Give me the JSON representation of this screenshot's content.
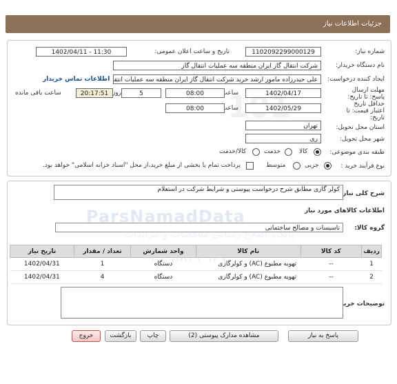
{
  "header": {
    "title": "جزئیات اطلاعات نیاز"
  },
  "info": {
    "need_number_label": "شماره نیاز:",
    "need_number": "1102092299000129",
    "announce_label": "تاریخ و ساعت اعلان عمومی:",
    "announce_value": "1402/04/11 - 11:30",
    "buyer_org_label": "نام دستگاه خریدار:",
    "buyer_org": "شرکت انتقال گاز ایران منطقه سه عملیات انتقال گاز",
    "creator_label": "ایجاد کننده درخواست:",
    "creator": "علی حیدرزاده مامور ارشد خرید شرکت انتقال گاز ایران منطقه سه عملیات انتقال",
    "contact_link": "اطلاعات تماس خریدار",
    "send_deadline_label": "مهلت ارسال پاسخ: تا تاریخ:",
    "send_deadline_date": "1402/04/17",
    "time_label": "ساعت",
    "send_deadline_time": "08:00",
    "days": "5",
    "day_and_label": "روز و",
    "remaining_time": "20:17:51",
    "remaining_label": "ساعت باقی مانده",
    "validity_label": "حداقل تاریخ اعتبار قیمت: تا تاریخ:",
    "validity_date": "1402/05/29",
    "validity_time_label": "ساعت",
    "validity_time": "08:00",
    "province_label": "استان محل تحویل:",
    "province": "تهران",
    "city_label": "شهر محل تحویل:",
    "city": "ری",
    "category_label": "طبقه بندی موضوعی:",
    "category_options": [
      "کالا",
      "خدمت",
      "کالا/خدمت"
    ],
    "process_label": "نوع فرآیند خرید :",
    "process_options": [
      "جزیی",
      "متوسط"
    ],
    "payment_note": "پرداخت تمام یا بخشی از مبلغ خرید،از محل \"اسناد خزانه اسلامی\" خواهد بود."
  },
  "details": {
    "summary_label": "شرح کلی نیاز:",
    "summary": "کولر گازی مطابق شرح درخواست پیوستی و شرایط شرکت در استعلام",
    "goods_info_title": "اطلاعات کالاهای مورد نیاز",
    "group_label": "گروه کالا:",
    "group_value": "تاسیسات و مصالح ساختمانی",
    "columns": [
      "ردیف",
      "کد کالا",
      "نام کالا",
      "واحد شمارش",
      "تعداد / مقدار",
      "تاریخ نیاز"
    ],
    "rows": [
      [
        "1",
        "--",
        "تهویه مطبوع (AC) و کولرگازی",
        "دستگاه",
        "1",
        "1402/04/31"
      ],
      [
        "2",
        "--",
        "تهویه مطبوع (AC) و کولرگازی",
        "دستگاه",
        "4",
        "1402/04/31"
      ]
    ],
    "buyer_notes_label": "توضیحات خریدار:"
  },
  "watermark": {
    "text": "ParsNamadData",
    "subtext": "پایگاه اطلاع رسانی مناقصات و مزایدات",
    "phone": "۰۲۱-۸۸۳۴۹۶۷۰",
    "logo": "101"
  },
  "buttons": {
    "reply": "پاسخ به نیاز",
    "view_docs": "مشاهده مدارک پیوستی (2)",
    "print": "چاپ",
    "back": "بازگشت",
    "exit": "خروج"
  }
}
